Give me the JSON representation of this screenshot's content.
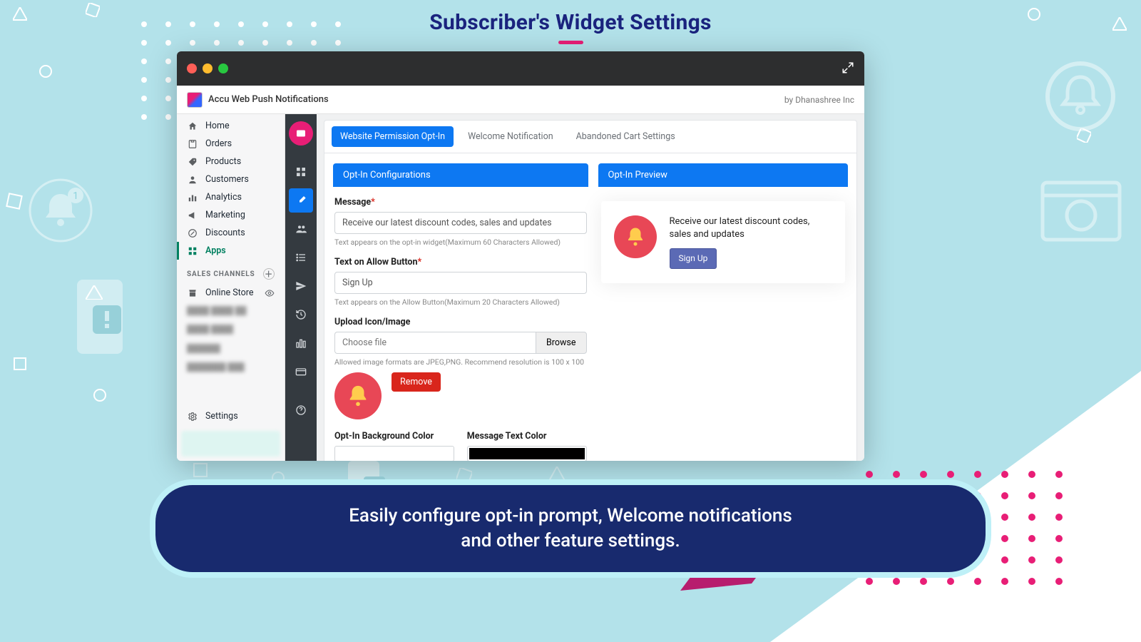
{
  "page": {
    "title": "Subscriber's Widget Settings",
    "caption_line1": "Easily configure opt-in prompt, Welcome notifications",
    "caption_line2": "and other feature settings."
  },
  "app_header": {
    "name": "Accu Web Push Notifications",
    "byline": "by Dhanashree Inc"
  },
  "sidebar": {
    "items": [
      {
        "icon": "home",
        "label": "Home"
      },
      {
        "icon": "orders",
        "label": "Orders"
      },
      {
        "icon": "products",
        "label": "Products"
      },
      {
        "icon": "customers",
        "label": "Customers"
      },
      {
        "icon": "analytics",
        "label": "Analytics"
      },
      {
        "icon": "marketing",
        "label": "Marketing"
      },
      {
        "icon": "discounts",
        "label": "Discounts"
      },
      {
        "icon": "apps",
        "label": "Apps",
        "active": true
      }
    ],
    "section": "SALES CHANNELS",
    "online_store": "Online Store",
    "settings": "Settings"
  },
  "tabs": {
    "t1": "Website Permission Opt-In",
    "t2": "Welcome Notification",
    "t3": "Abandoned Cart Settings"
  },
  "config": {
    "head": "Opt-In Configurations",
    "msg_label": "Message",
    "msg_value": "Receive our latest discount codes, sales and updates",
    "msg_note": "Text appears on the opt-in widget(Maximum 60 Characters Allowed)",
    "allow_label": "Text on Allow Button",
    "allow_value": "Sign Up",
    "allow_note": "Text appears on the Allow Button(Maximum 20 Characters Allowed)",
    "upload_label": "Upload Icon/Image",
    "file_placeholder": "Choose file",
    "browse": "Browse",
    "upload_note": "Allowed image formats are JPEG,PNG. Recommend resolution is 100 x 100",
    "remove": "Remove",
    "bg_label": "Opt-In Background Color",
    "bg_value": "#ffffff",
    "txt_label": "Message Text Color",
    "txt_value": "#000000"
  },
  "preview": {
    "head": "Opt-In Preview",
    "text": "Receive our latest discount codes, sales and updates",
    "button": "Sign Up"
  }
}
